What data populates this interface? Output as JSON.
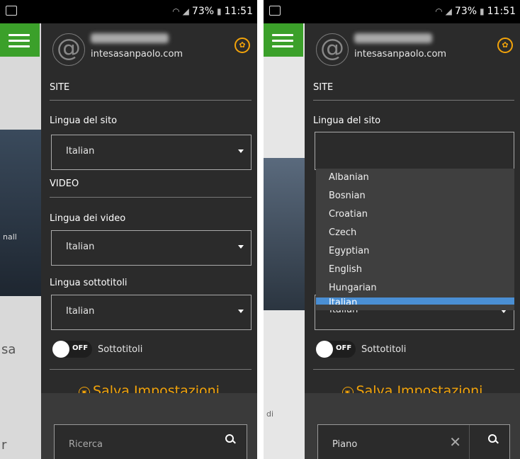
{
  "statusbar": {
    "battery": "73%",
    "time": "11:51"
  },
  "panel1": {
    "domain": "intesasanpaolo.com",
    "site_title": "SITE",
    "site_lang_label": "Lingua del sito",
    "site_lang_value": "Italian",
    "video_title": "VIDEO",
    "video_lang_label": "Lingua dei video",
    "video_lang_value": "Italian",
    "subs_lang_label": "Lingua sottotitoli",
    "subs_lang_value": "Italian",
    "toggle_text": "OFF",
    "toggle_label": "Sottotitoli",
    "save_label": "Salva Impostazioni",
    "search_placeholder": "Ricerca",
    "bg_text_1": "nall",
    "bg_text_2": "sa",
    "bg_text_3": "r"
  },
  "panel2": {
    "domain": "intesasanpaolo.com",
    "site_title": "SITE",
    "site_lang_label": "Lingua del sito",
    "dropdown_options": [
      "Albanian",
      "Bosnian",
      "Croatian",
      "Czech",
      "Egyptian",
      "English",
      "Hungarian",
      "Italian"
    ],
    "underlying_value": "Italian",
    "toggle_text": "OFF",
    "toggle_label": "Sottotitoli",
    "save_label": "Salva Impostazioni",
    "search_value": "Piano",
    "bg_text_1": "di"
  },
  "colors": {
    "accent": "#f2a30a",
    "menu_green": "#3ba02a",
    "drawer_bg": "#2b2b2b",
    "selection_blue": "#4a8fd4"
  },
  "icons": [
    "image-icon",
    "wifi-icon",
    "signal-icon",
    "battery-icon",
    "hamburger-icon",
    "at-icon",
    "gear-icon",
    "caret-down-icon",
    "disk-icon",
    "search-icon",
    "close-icon"
  ]
}
